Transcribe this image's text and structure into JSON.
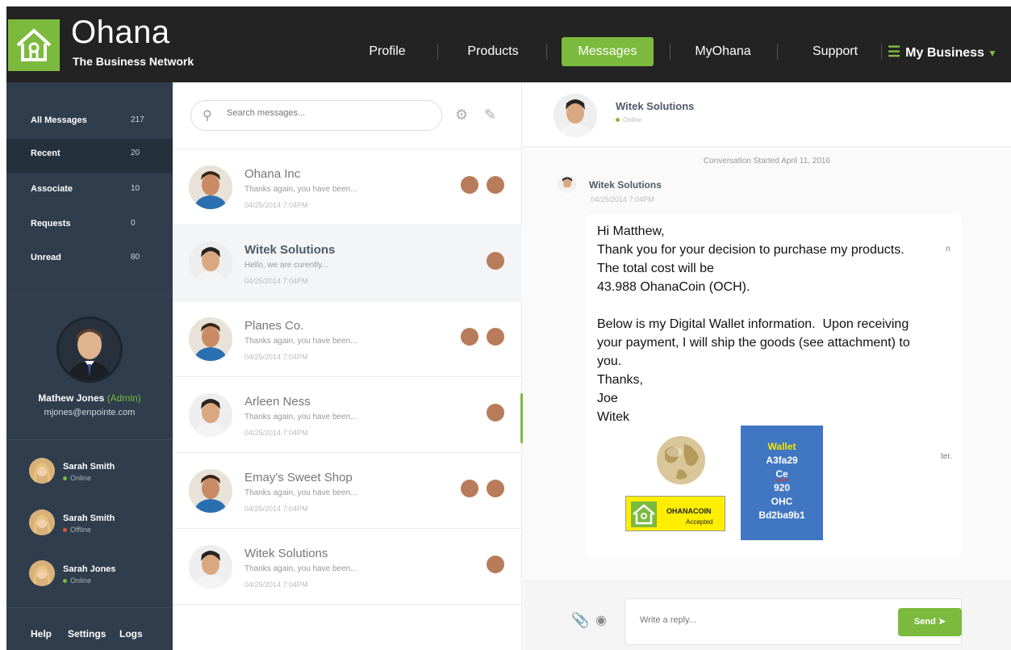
{
  "brand": {
    "name": "Ohana",
    "tagline": "The Business Network",
    "accent": "#7cba3d"
  },
  "nav": {
    "items": [
      "Profile",
      "Products",
      "Messages",
      "MyOhana",
      "Support"
    ],
    "active": "Messages",
    "business": "My Business"
  },
  "folders": [
    {
      "label": "All Messages",
      "count": "217"
    },
    {
      "label": "Recent",
      "count": "20"
    },
    {
      "label": "Associate",
      "count": "10"
    },
    {
      "label": "Requests",
      "count": "0"
    },
    {
      "label": "Unread",
      "count": "80"
    }
  ],
  "user": {
    "name": "Mathew Jones",
    "role": "(Admin)",
    "email": "mjones@enpointe.com"
  },
  "contacts": [
    {
      "name": "Sarah Smith",
      "status": "Online",
      "status_color": "#7cba3d"
    },
    {
      "name": "Sarah Smith",
      "status": "Offline",
      "status_color": "#e0503a"
    },
    {
      "name": "Sarah Jones",
      "status": "Online",
      "status_color": "#7cba3d"
    }
  ],
  "footer": {
    "help": "Help",
    "settings": "Settings",
    "logs": "Logs"
  },
  "search": {
    "placeholder": "Search messages..."
  },
  "messages": [
    {
      "name": "Ohana Inc",
      "preview": "Thanks again, you have been...",
      "time": "04/25/2014   7:04PM"
    },
    {
      "name": "Witek Solutions",
      "preview": "Hello, we are curently...",
      "time": "04/25/2014   7:04PM"
    },
    {
      "name": "Planes Co.",
      "preview": "Thanks again, you have been...",
      "time": "04/25/2014   7:04PM"
    },
    {
      "name": "Arleen Ness",
      "preview": "Thanks again, you have been...",
      "time": "04/25/2014   7:04PM"
    },
    {
      "name": "Emay's Sweet Shop",
      "preview": "Thanks again, you have been...",
      "time": "04/25/2014   7:04PM"
    },
    {
      "name": "Witek Solutions",
      "preview": "Thanks again, you have been...",
      "time": "04/25/2014   7:04PM"
    }
  ],
  "chat": {
    "contact": "Witek Solutions",
    "status": "Online",
    "started": "Conversation Started April 11, 2016",
    "sender": "Witek Solutions",
    "sent_time": "04/25/2014   7:04PM",
    "body": "Hi Matthew,\nThank you for your decision to purchase my products.  The total cost will be\n43.988 OhanaCoin (OCH).\n\nBelow is my Digital Wallet information.  Upon receiving your payment, I will ship the goods (see attachment) to you.\nThanks,\nJoe\nWitek",
    "edge_text_1": "n",
    "edge_text_2": "ter.",
    "badge_title": "OHANACOIN",
    "badge_sub": "Accepted",
    "wallet": {
      "title": "Wallet",
      "line1": "A3fa29",
      "line2": "Ce",
      "line3": "920",
      "line4": "OHC",
      "line5": "Bd2ba9b1"
    },
    "reply_placeholder": "Write a reply...",
    "send_label": "Send"
  }
}
